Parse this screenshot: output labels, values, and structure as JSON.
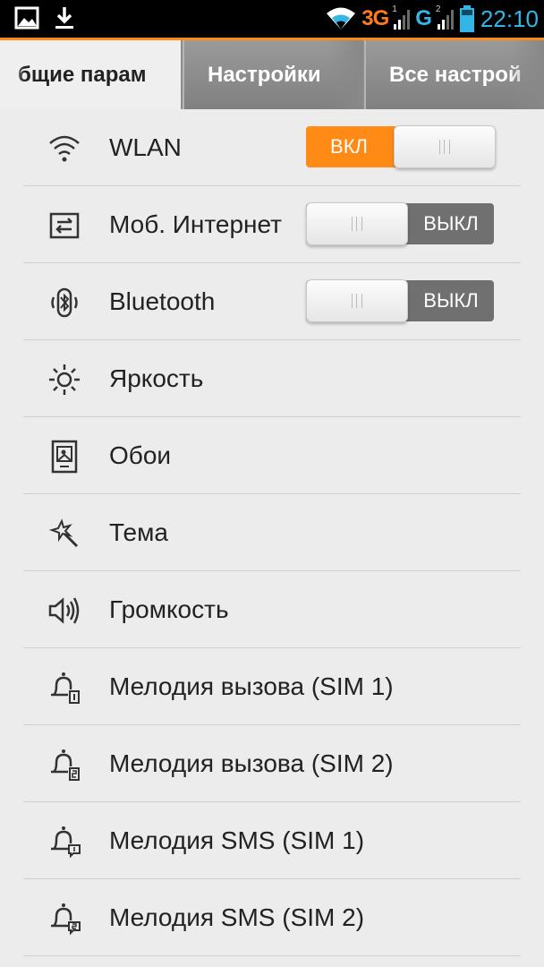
{
  "status_bar": {
    "icons_left": [
      "gallery-icon",
      "download-icon"
    ],
    "network_1": "3G",
    "sim1_index": "1",
    "network_2": "G",
    "sim2_index": "2",
    "time": "22:10",
    "colors": {
      "network_1": "#ff7a1a",
      "accent": "#33b5e5"
    }
  },
  "tabs": [
    {
      "label": "бщие парам",
      "active": true
    },
    {
      "label": "Настройки",
      "active": false
    },
    {
      "label": "Все настрой",
      "active": false
    }
  ],
  "settings": {
    "wlan": {
      "label": "WLAN",
      "icon": "wifi-icon",
      "toggle": "ВКЛ"
    },
    "mobile_internet": {
      "label": "Моб. Интернет",
      "icon": "mobile-data-icon",
      "toggle": "ВЫКЛ"
    },
    "bluetooth": {
      "label": "Bluetooth",
      "icon": "bluetooth-icon",
      "toggle": "ВЫКЛ"
    },
    "brightness": {
      "label": "Яркость",
      "icon": "brightness-icon"
    },
    "wallpaper": {
      "label": "Обои",
      "icon": "wallpaper-icon"
    },
    "theme": {
      "label": "Тема",
      "icon": "theme-wand-icon"
    },
    "volume": {
      "label": "Громкость",
      "icon": "volume-icon"
    },
    "ringtone_sim1": {
      "label": "Мелодия вызова (SIM 1)",
      "icon": "bell-sim1-icon"
    },
    "ringtone_sim2": {
      "label": "Мелодия вызова (SIM 2)",
      "icon": "bell-sim2-icon"
    },
    "sms_sim1": {
      "label": "Мелодия SMS (SIM 1)",
      "icon": "bell-sms1-icon"
    },
    "sms_sim2": {
      "label": "Мелодия SMS (SIM 2)",
      "icon": "bell-sms2-icon"
    }
  },
  "colors": {
    "toggle_on": "#ff8a16",
    "toggle_off": "#707070",
    "tab_indicator": "#ff8a1c"
  }
}
